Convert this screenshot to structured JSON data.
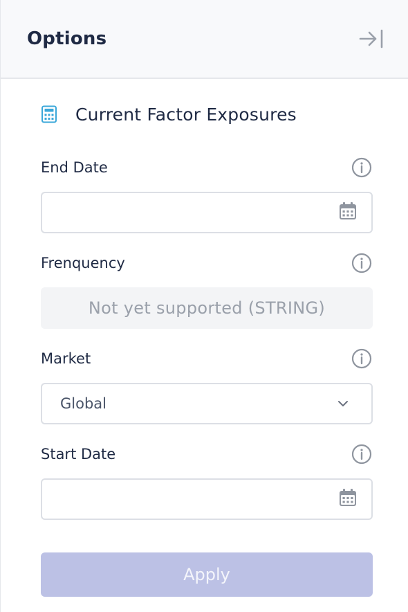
{
  "header": {
    "title": "Options",
    "collapse_icon": "collapse-right-icon"
  },
  "section": {
    "title": "Current Factor Exposures",
    "icon": "calculator-icon",
    "icon_color": "#3aa7d9"
  },
  "fields": {
    "end_date": {
      "label": "End Date",
      "value": "",
      "icon": "calendar-icon"
    },
    "frequency": {
      "label": "Frenquency",
      "unsupported_text": "Not yet supported (STRING)"
    },
    "market": {
      "label": "Market",
      "selected": "Global",
      "icon": "chevron-down-icon"
    },
    "start_date": {
      "label": "Start Date",
      "value": "",
      "icon": "calendar-icon"
    }
  },
  "apply": {
    "label": "Apply",
    "color": "#bcc1e5"
  }
}
